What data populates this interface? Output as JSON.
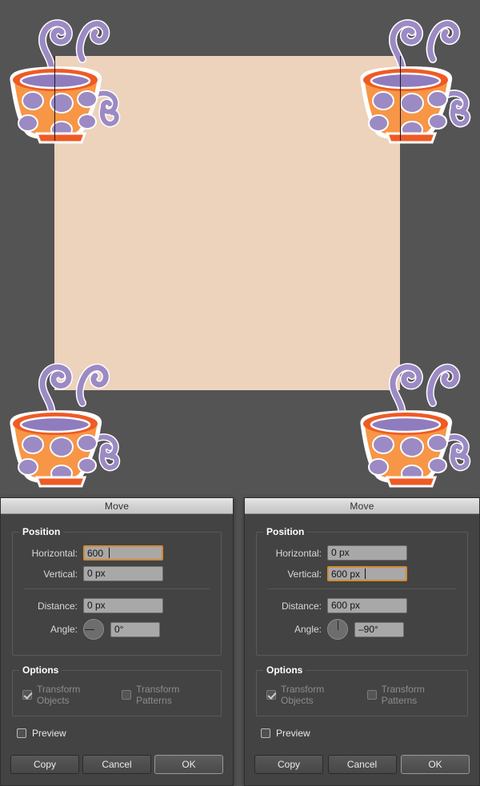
{
  "canvas": {
    "background_color": "#545454",
    "artboard_color": "#EDD2BC",
    "artwork_name": "teacup-pattern-tile",
    "cup_colors": {
      "body": "#F79646",
      "dots": "#9B8AC4",
      "rim": "#EE5B24",
      "interior": "#8E7CBE",
      "outline": "#FFFFFF",
      "steam": "#9B8AC4"
    },
    "guides": [
      "artboard-left-edge",
      "artboard-right-edge"
    ]
  },
  "dialogs": [
    {
      "title": "Move",
      "position_group": {
        "title": "Position",
        "horizontal_label": "Horizontal:",
        "horizontal_value": "600",
        "horizontal_focused": true,
        "vertical_label": "Vertical:",
        "vertical_value": "0 px",
        "distance_label": "Distance:",
        "distance_value": "0 px",
        "angle_label": "Angle:",
        "angle_value": "0°",
        "angle_dial": "needle-left"
      },
      "options_group": {
        "title": "Options",
        "transform_objects_label": "Transform Objects",
        "transform_objects_checked": true,
        "transform_patterns_label": "Transform Patterns",
        "transform_patterns_checked": false
      },
      "preview_label": "Preview",
      "preview_checked": false,
      "buttons": {
        "copy": "Copy",
        "cancel": "Cancel",
        "ok": "OK"
      }
    },
    {
      "title": "Move",
      "position_group": {
        "title": "Position",
        "horizontal_label": "Horizontal:",
        "horizontal_value": "0 px",
        "horizontal_focused": false,
        "vertical_label": "Vertical:",
        "vertical_value": "600 px",
        "distance_label": "Distance:",
        "distance_value": "600 px",
        "angle_label": "Angle:",
        "angle_value": "–90°",
        "angle_dial": "needle-up"
      },
      "options_group": {
        "title": "Options",
        "transform_objects_label": "Transform Objects",
        "transform_objects_checked": true,
        "transform_patterns_label": "Transform Patterns",
        "transform_patterns_checked": false
      },
      "preview_label": "Preview",
      "preview_checked": false,
      "buttons": {
        "copy": "Copy",
        "cancel": "Cancel",
        "ok": "OK"
      }
    }
  ]
}
